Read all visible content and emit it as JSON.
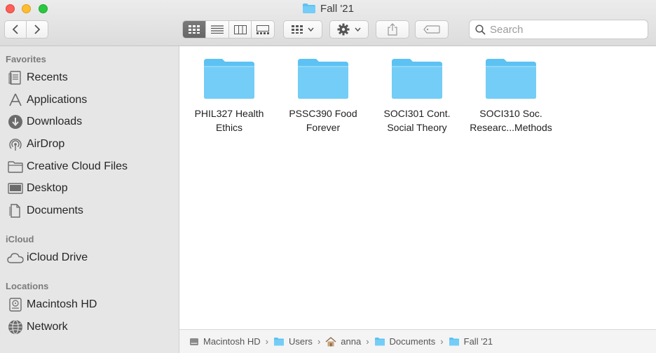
{
  "window": {
    "title": "Fall '21"
  },
  "toolbar": {
    "search_placeholder": "Search",
    "view_modes": [
      "icon",
      "list",
      "column",
      "gallery"
    ],
    "active_view": "icon"
  },
  "sidebar": {
    "sections": [
      {
        "title": "Favorites",
        "items": [
          {
            "label": "Recents",
            "icon": "clock-icon"
          },
          {
            "label": "Applications",
            "icon": "applications-icon"
          },
          {
            "label": "Downloads",
            "icon": "download-icon"
          },
          {
            "label": "AirDrop",
            "icon": "airdrop-icon"
          },
          {
            "label": "Creative Cloud Files",
            "icon": "folder-icon"
          },
          {
            "label": "Desktop",
            "icon": "desktop-icon"
          },
          {
            "label": "Documents",
            "icon": "document-icon"
          }
        ]
      },
      {
        "title": "iCloud",
        "items": [
          {
            "label": "iCloud Drive",
            "icon": "cloud-icon"
          }
        ]
      },
      {
        "title": "Locations",
        "items": [
          {
            "label": "Macintosh HD",
            "icon": "harddrive-icon"
          },
          {
            "label": "Network",
            "icon": "network-icon"
          }
        ]
      }
    ]
  },
  "content": {
    "folders": [
      {
        "line1": "PHIL327 Health",
        "line2": "Ethics"
      },
      {
        "line1": "PSSC390 Food",
        "line2": "Forever"
      },
      {
        "line1": "SOCI301  Cont.",
        "line2": "Social Theory"
      },
      {
        "line1": "SOCI310 Soc.",
        "line2": "Researc...Methods"
      }
    ]
  },
  "pathbar": {
    "crumbs": [
      "Macintosh HD",
      "Users",
      "anna",
      "Documents",
      "Fall '21"
    ]
  },
  "colors": {
    "folder": "#5cc2f3",
    "folder_light": "#8fd6f8",
    "sidebar_bg": "#e7e6e7"
  }
}
